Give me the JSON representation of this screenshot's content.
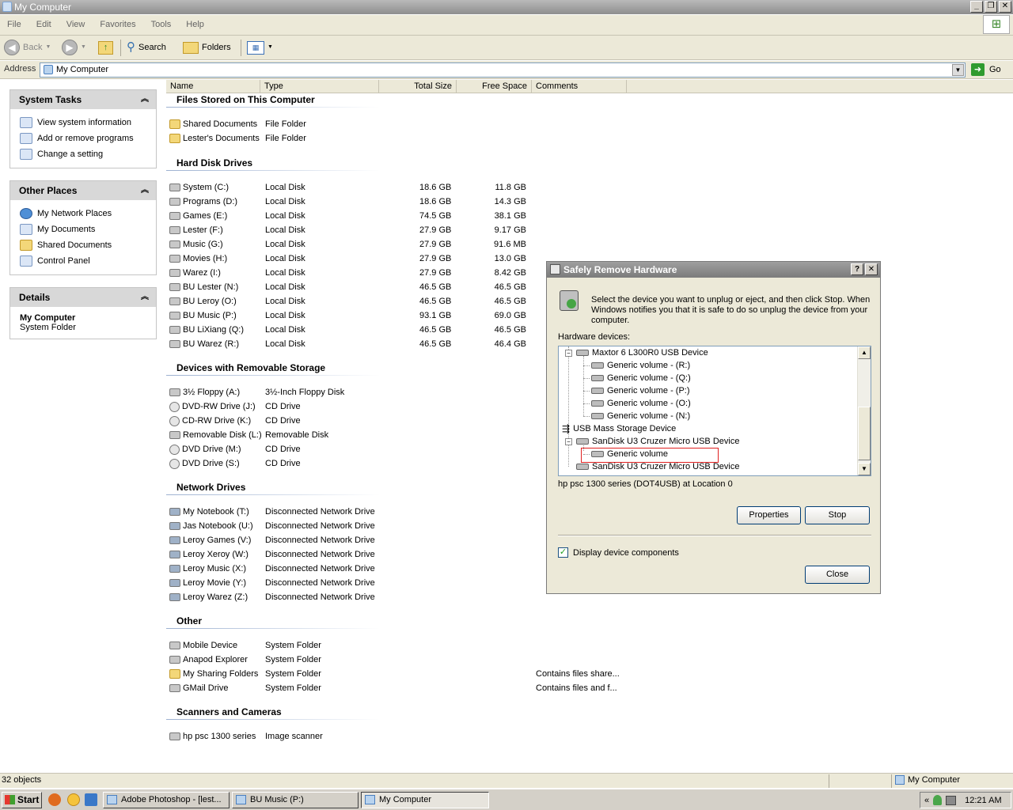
{
  "window": {
    "title": "My Computer"
  },
  "menu": [
    "File",
    "Edit",
    "View",
    "Favorites",
    "Tools",
    "Help"
  ],
  "toolbar": {
    "back": "Back",
    "search": "Search",
    "folders": "Folders"
  },
  "address": {
    "label": "Address",
    "value": "My Computer",
    "go": "Go"
  },
  "columns": {
    "name": "Name",
    "type": "Type",
    "total": "Total Size",
    "free": "Free Space",
    "comments": "Comments"
  },
  "left": {
    "system_tasks": {
      "title": "System Tasks",
      "items": [
        "View system information",
        "Add or remove programs",
        "Change a setting"
      ]
    },
    "other_places": {
      "title": "Other Places",
      "items": [
        "My Network Places",
        "My Documents",
        "Shared Documents",
        "Control Panel"
      ]
    },
    "details": {
      "title": "Details",
      "name": "My Computer",
      "desc": "System Folder"
    }
  },
  "groups": [
    {
      "title": "Files Stored on This Computer",
      "rows": [
        {
          "name": "Shared Documents",
          "type": "File Folder",
          "icon": "folder-icon"
        },
        {
          "name": "Lester's Documents",
          "type": "File Folder",
          "icon": "folder-icon"
        }
      ]
    },
    {
      "title": "Hard Disk Drives",
      "rows": [
        {
          "name": "System (C:)",
          "type": "Local Disk",
          "total": "18.6 GB",
          "free": "11.8 GB",
          "icon": "hard-disk-icon"
        },
        {
          "name": "Programs (D:)",
          "type": "Local Disk",
          "total": "18.6 GB",
          "free": "14.3 GB",
          "icon": "hard-disk-icon"
        },
        {
          "name": "Games (E:)",
          "type": "Local Disk",
          "total": "74.5 GB",
          "free": "38.1 GB",
          "icon": "hard-disk-icon"
        },
        {
          "name": "Lester (F:)",
          "type": "Local Disk",
          "total": "27.9 GB",
          "free": "9.17 GB",
          "icon": "hard-disk-icon"
        },
        {
          "name": "Music (G:)",
          "type": "Local Disk",
          "total": "27.9 GB",
          "free": "91.6 MB",
          "icon": "hard-disk-icon"
        },
        {
          "name": "Movies (H:)",
          "type": "Local Disk",
          "total": "27.9 GB",
          "free": "13.0 GB",
          "icon": "hard-disk-icon"
        },
        {
          "name": "Warez (I:)",
          "type": "Local Disk",
          "total": "27.9 GB",
          "free": "8.42 GB",
          "icon": "hard-disk-icon"
        },
        {
          "name": "BU Lester (N:)",
          "type": "Local Disk",
          "total": "46.5 GB",
          "free": "46.5 GB",
          "icon": "hard-disk-icon"
        },
        {
          "name": "BU Leroy (O:)",
          "type": "Local Disk",
          "total": "46.5 GB",
          "free": "46.5 GB",
          "icon": "hard-disk-icon"
        },
        {
          "name": "BU Music (P:)",
          "type": "Local Disk",
          "total": "93.1 GB",
          "free": "69.0 GB",
          "icon": "hard-disk-icon"
        },
        {
          "name": "BU LiXiang (Q:)",
          "type": "Local Disk",
          "total": "46.5 GB",
          "free": "46.5 GB",
          "icon": "hard-disk-icon"
        },
        {
          "name": "BU Warez (R:)",
          "type": "Local Disk",
          "total": "46.5 GB",
          "free": "46.4 GB",
          "icon": "hard-disk-icon"
        }
      ]
    },
    {
      "title": "Devices with Removable Storage",
      "rows": [
        {
          "name": "3½ Floppy (A:)",
          "type": "3½-Inch Floppy Disk",
          "icon": "floppy-icon"
        },
        {
          "name": "DVD-RW Drive (J:)",
          "type": "CD Drive",
          "icon": "cd-drive-icon"
        },
        {
          "name": "CD-RW Drive (K:)",
          "type": "CD Drive",
          "icon": "cd-drive-icon"
        },
        {
          "name": "Removable Disk (L:)",
          "type": "Removable Disk",
          "icon": "removable-disk-icon"
        },
        {
          "name": "DVD Drive (M:)",
          "type": "CD Drive",
          "icon": "cd-drive-icon"
        },
        {
          "name": "DVD Drive (S:)",
          "type": "CD Drive",
          "icon": "cd-drive-icon"
        }
      ]
    },
    {
      "title": "Network Drives",
      "rows": [
        {
          "name": "My Notebook (T:)",
          "type": "Disconnected Network Drive",
          "icon": "network-drive-icon"
        },
        {
          "name": "Jas Notebook (U:)",
          "type": "Disconnected Network Drive",
          "icon": "network-drive-icon"
        },
        {
          "name": "Leroy Games (V:)",
          "type": "Disconnected Network Drive",
          "icon": "network-drive-icon"
        },
        {
          "name": "Leroy Xeroy (W:)",
          "type": "Disconnected Network Drive",
          "icon": "network-drive-icon"
        },
        {
          "name": "Leroy Music (X:)",
          "type": "Disconnected Network Drive",
          "icon": "network-drive-icon"
        },
        {
          "name": "Leroy Movie (Y:)",
          "type": "Disconnected Network Drive",
          "icon": "network-drive-icon"
        },
        {
          "name": "Leroy Warez (Z:)",
          "type": "Disconnected Network Drive",
          "icon": "network-drive-icon"
        }
      ]
    },
    {
      "title": "Other",
      "rows": [
        {
          "name": "Mobile Device",
          "type": "System Folder",
          "icon": "mobile-device-icon"
        },
        {
          "name": "Anapod Explorer",
          "type": "System Folder",
          "icon": "ipod-icon"
        },
        {
          "name": "My Sharing Folders",
          "type": "System Folder",
          "comment": "Contains files share...",
          "icon": "sharing-folder-icon"
        },
        {
          "name": "GMail Drive",
          "type": "System Folder",
          "comment": "Contains files and f...",
          "icon": "gmail-drive-icon"
        }
      ]
    },
    {
      "title": "Scanners and Cameras",
      "rows": [
        {
          "name": "hp psc 1300 series",
          "type": "Image scanner",
          "icon": "scanner-icon"
        }
      ]
    }
  ],
  "status": {
    "count": "32 objects",
    "location": "My Computer"
  },
  "taskbar": {
    "start": "Start",
    "tasks": [
      "Adobe Photoshop - [lest...",
      "BU Music (P:)",
      "My Computer"
    ],
    "clock": "12:21 AM"
  },
  "dialog": {
    "title": "Safely Remove Hardware",
    "intro": "Select the device you want to unplug or eject, and then click Stop. When Windows notifies you that it is safe to do so unplug the device from your computer.",
    "hw_label": "Hardware devices:",
    "tree": [
      "Maxtor 6 L300R0 USB Device",
      "Generic volume - (R:)",
      "Generic volume - (Q:)",
      "Generic volume - (P:)",
      "Generic volume - (O:)",
      "Generic volume - (N:)",
      "USB Mass Storage Device",
      "SanDisk U3 Cruzer Micro USB Device",
      "Generic volume",
      "SanDisk U3 Cruzer Micro USB Device"
    ],
    "location": "hp psc 1300 series (DOT4USB) at Location 0",
    "properties": "Properties",
    "stop": "Stop",
    "checkbox": "Display device components",
    "close": "Close"
  }
}
